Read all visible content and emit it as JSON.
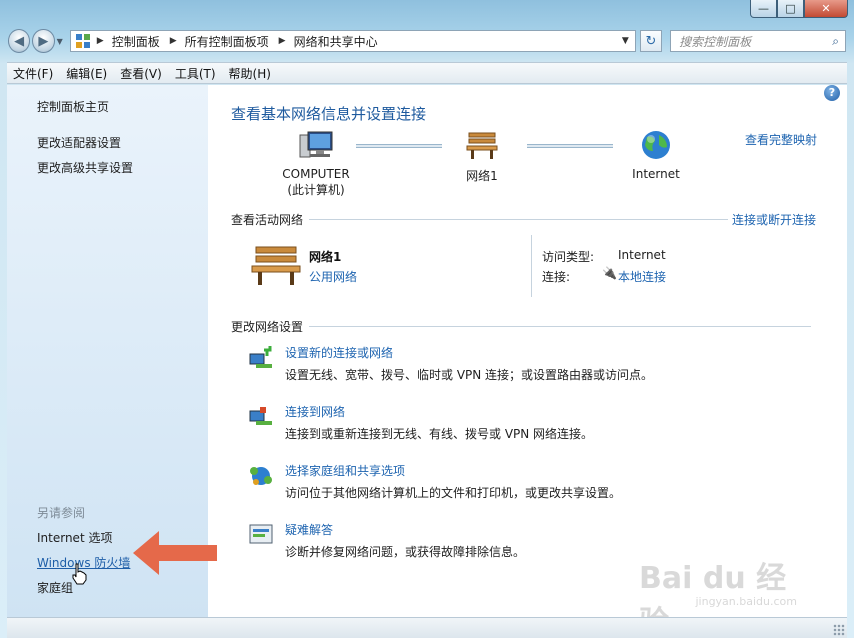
{
  "window": {
    "controls": {
      "minimize": "—",
      "maximize": "□",
      "close": "✕"
    }
  },
  "address": {
    "back": "◀",
    "forward": "▶",
    "breadcrumbs": [
      "控制面板",
      "所有控制面板项",
      "网络和共享中心"
    ],
    "refresh": "↻",
    "search_placeholder": "搜索控制面板",
    "search_icon": "search-icon"
  },
  "menu": {
    "items": [
      "文件(F)",
      "编辑(E)",
      "查看(V)",
      "工具(T)",
      "帮助(H)"
    ]
  },
  "left": {
    "links": [
      "控制面板主页",
      "更改适配器设置",
      "更改高级共享设置"
    ],
    "see_also_title": "另请参阅",
    "see_also": [
      "Internet 选项",
      "Windows 防火墙",
      "家庭组"
    ]
  },
  "main": {
    "help": "?",
    "title": "查看基本网络信息并设置连接",
    "full_map": "查看完整映射",
    "map": {
      "computer_line1": "COMPUTER",
      "computer_line2": "(此计算机)",
      "network": "网络1",
      "internet": "Internet"
    },
    "active_header": "查看活动网络",
    "connect_link": "连接或断开连接",
    "active": {
      "name": "网络1",
      "type": "公用网络",
      "access_label": "访问类型:",
      "access_value": "Internet",
      "conn_label": "连接:",
      "conn_value": "本地连接"
    },
    "change_header": "更改网络设置",
    "tasks": [
      {
        "title": "设置新的连接或网络",
        "desc": "设置无线、宽带、拨号、临时或 VPN 连接；或设置路由器或访问点。"
      },
      {
        "title": "连接到网络",
        "desc": "连接到或重新连接到无线、有线、拨号或 VPN 网络连接。"
      },
      {
        "title": "选择家庭组和共享选项",
        "desc": "访问位于其他网络计算机上的文件和打印机，或更改共享设置。"
      },
      {
        "title": "疑难解答",
        "desc": "诊断并修复网络问题，或获得故障排除信息。"
      }
    ]
  },
  "watermark": {
    "line1": "Bai du 经验",
    "line2": "jingyan.baidu.com"
  },
  "colors": {
    "link": "#1e64b0",
    "title": "#1e5a9e",
    "arrow": "#e5694a"
  }
}
